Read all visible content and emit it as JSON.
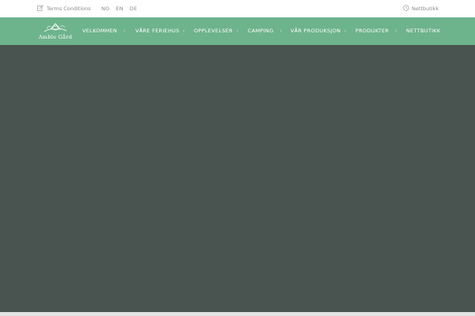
{
  "topbar": {
    "terms_label": "Terms Conditions",
    "terms_icon": "edit-icon",
    "languages": [
      "NO",
      "EN",
      "DE"
    ],
    "shop_label": "Nettbutikk",
    "shop_icon": "clock-icon"
  },
  "brand": {
    "logo_text": "Amble Gård"
  },
  "nav": {
    "items": [
      "VELKOMMEN",
      "VÅRE FERIEHUS",
      "OPPLEVELSER",
      "CAMPING",
      "VÅR PRODUKSJON",
      "PRODUKTER",
      "NETTBUTIKK"
    ]
  },
  "colors": {
    "nav_background": "#6db38c",
    "hero_background": "#49534f",
    "topbar_text": "#8a8a8a"
  }
}
